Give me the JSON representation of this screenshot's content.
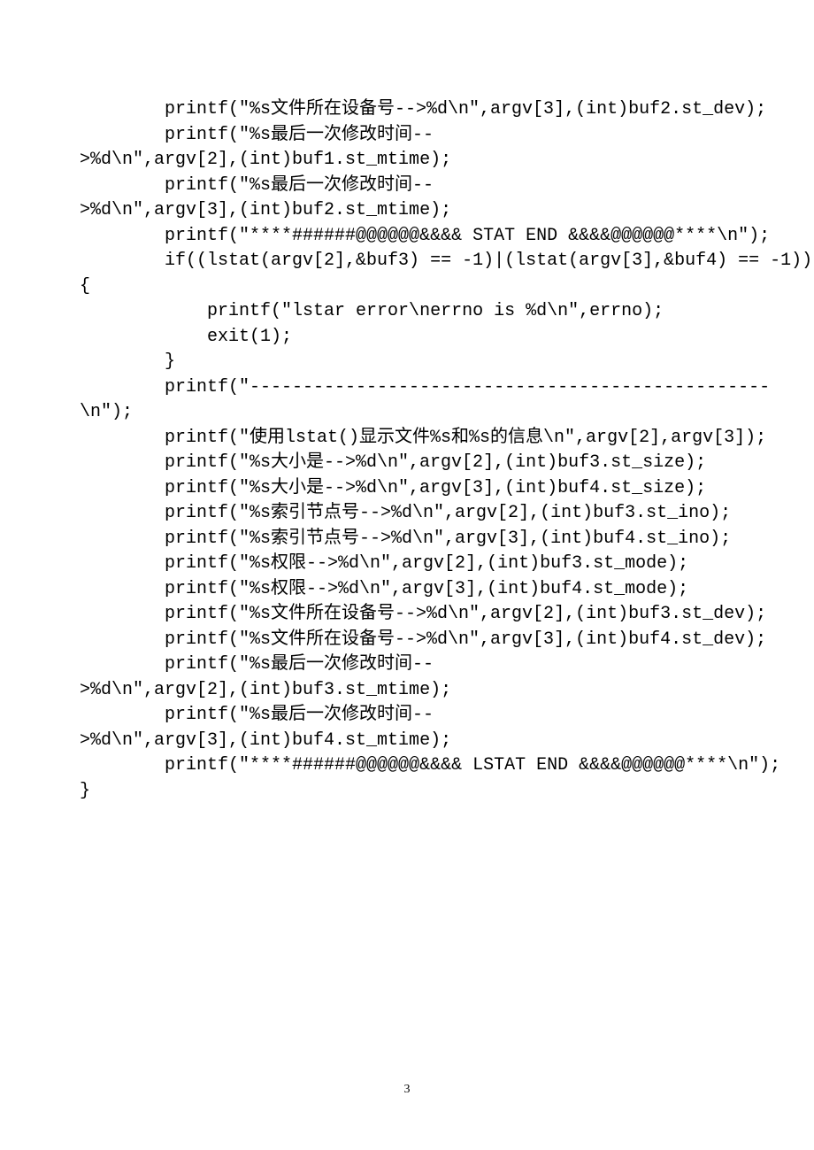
{
  "code_lines": [
    "        printf(\"%s文件所在设备号-->%d\\n\",argv[3],(int)buf2.st_dev);",
    "        printf(\"%s最后一次修改时间--",
    ">%d\\n\",argv[2],(int)buf1.st_mtime);",
    "        printf(\"%s最后一次修改时间--",
    ">%d\\n\",argv[3],(int)buf2.st_mtime);",
    "        printf(\"****######@@@@@@&&&& STAT END &&&&@@@@@@****\\n\");",
    "        if((lstat(argv[2],&buf3) == -1)|(lstat(argv[3],&buf4) == -1))",
    "{",
    "            printf(\"lstar error\\nerrno is %d\\n\",errno);",
    "            exit(1);",
    "        }",
    "        printf(\"-------------------------------------------------",
    "\\n\");",
    "        printf(\"使用lstat()显示文件%s和%s的信息\\n\",argv[2],argv[3]);",
    "        printf(\"%s大小是-->%d\\n\",argv[2],(int)buf3.st_size);",
    "        printf(\"%s大小是-->%d\\n\",argv[3],(int)buf4.st_size);",
    "        printf(\"%s索引节点号-->%d\\n\",argv[2],(int)buf3.st_ino);",
    "        printf(\"%s索引节点号-->%d\\n\",argv[3],(int)buf4.st_ino);",
    "        printf(\"%s权限-->%d\\n\",argv[2],(int)buf3.st_mode);",
    "        printf(\"%s权限-->%d\\n\",argv[3],(int)buf4.st_mode);",
    "        printf(\"%s文件所在设备号-->%d\\n\",argv[2],(int)buf3.st_dev);",
    "        printf(\"%s文件所在设备号-->%d\\n\",argv[3],(int)buf4.st_dev);",
    "        printf(\"%s最后一次修改时间--",
    ">%d\\n\",argv[2],(int)buf3.st_mtime);",
    "        printf(\"%s最后一次修改时间--",
    ">%d\\n\",argv[3],(int)buf4.st_mtime);",
    "        printf(\"****######@@@@@@&&&& LSTAT END &&&&@@@@@@****\\n\");",
    "}"
  ],
  "page_number": "3"
}
